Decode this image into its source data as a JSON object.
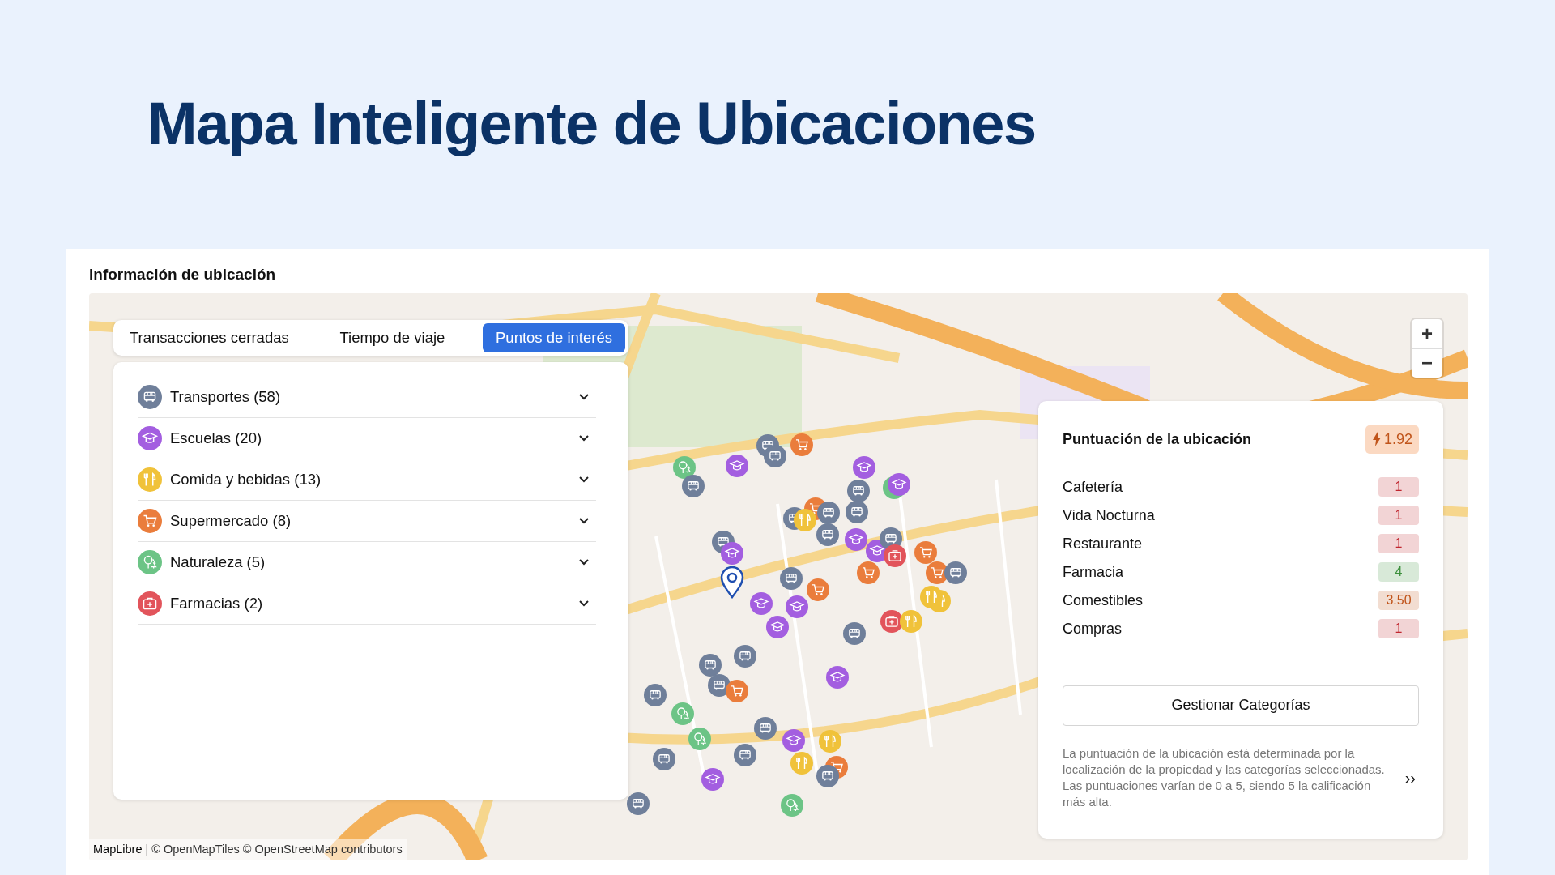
{
  "page": {
    "title": "Mapa Inteligente de Ubicaciones"
  },
  "section": {
    "title": "Información de ubicación"
  },
  "tabs": [
    {
      "label": "Transacciones cerradas",
      "selected": false
    },
    {
      "label": "Tiempo de viaje",
      "selected": false
    },
    {
      "label": "Puntos de interés",
      "selected": true
    }
  ],
  "poi_categories": [
    {
      "kind": "transport",
      "label": "Transportes (58)",
      "color": "#6f7f9a",
      "expanded": false
    },
    {
      "kind": "school",
      "label": "Escuelas (20)",
      "color": "#a35ee0",
      "expanded": false
    },
    {
      "kind": "food",
      "label": "Comida y bebidas (13)",
      "color": "#f0c23a",
      "expanded": false
    },
    {
      "kind": "grocery",
      "label": "Supermercado (8)",
      "color": "#ea7d3c",
      "expanded": false
    },
    {
      "kind": "nature",
      "label": "Naturaleza (5)",
      "color": "#6cc486",
      "expanded": false
    },
    {
      "kind": "pharmacy",
      "label": "Farmacias (2)",
      "color": "#e2545b",
      "expanded": false
    }
  ],
  "score_panel": {
    "title": "Puntuación de la ubicación",
    "score": "1.92",
    "rows": [
      {
        "label": "Cafetería",
        "value": "1",
        "color": "#c0262f"
      },
      {
        "label": "Vida Nocturna",
        "value": "1",
        "color": "#c0262f"
      },
      {
        "label": "Restaurante",
        "value": "1",
        "color": "#c0262f"
      },
      {
        "label": "Farmacia",
        "value": "4",
        "color": "#3c8f3c"
      },
      {
        "label": "Comestibles",
        "value": "3.50",
        "color": "#c0541a"
      },
      {
        "label": "Compras",
        "value": "1",
        "color": "#c0262f"
      }
    ],
    "button": "Gestionar Categorías",
    "description": "La puntuación de la ubicación está determinada por la localización de la propiedad y las categorías seleccionadas. Las puntuaciones varían de 0 a 5, siendo 5 la calificación más alta.",
    "more": "››"
  },
  "zoom": {
    "in": "+",
    "out": "−"
  },
  "attribution": {
    "link": "MapLibre",
    "text": "| © OpenMapTiles © OpenStreetMap contributors"
  }
}
